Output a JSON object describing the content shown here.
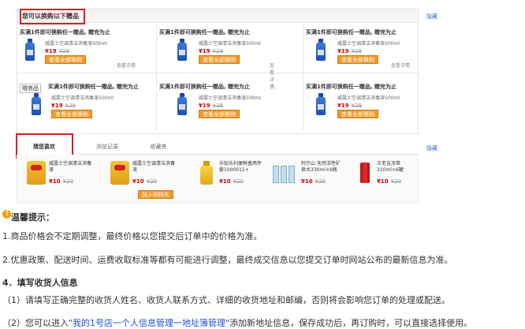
{
  "gift": {
    "title": "您可以换购以下赠品",
    "hide": "隐藏",
    "offer": "买满1件即可换购任一赠品, 赠完为止",
    "product": "威露士空调清洁消毒液500ml",
    "price": "¥19",
    "orig_price": "¥29",
    "button": "查看全部换购",
    "detail": "查看详情",
    "tag": "赠商品"
  },
  "tabs": {
    "items": [
      "猜您喜欢",
      "浏览记录",
      "收藏夹"
    ],
    "hide": "隐藏"
  },
  "recs": [
    {
      "name": "威露士空调清洁消毒液",
      "price": "¥10",
      "orig": "¥20",
      "icon": "chips-bag-icon"
    },
    {
      "name": "威露士空调清洁消毒液",
      "price": "¥10",
      "orig": "¥20",
      "icon": "chips-bag-icon"
    },
    {
      "name": "乐知乐扫便鲜盒两件套1000011+",
      "price": "¥10",
      "orig": "¥20",
      "icon": "bottle-icon"
    },
    {
      "name": "阿尔山 天然活性矿泉水330ml×6瓶",
      "price": "¥10",
      "orig": "¥20",
      "icon": "water-bottles-icon"
    },
    {
      "name": "王老吉凉茶310ml×6罐",
      "price": "¥10",
      "orig": "¥20",
      "icon": "can-icon"
    }
  ],
  "add_cart": "加入购物车",
  "tips": {
    "heading": "温馨提示：",
    "line1": "1.商品价格会不定期调整，最终价格以您提交后订单中的价格为准。",
    "line2": "2.优惠政策、配送时间、运费收取标准等都有可能进行调整，最终成交信息以您提交订单时网站公布的最新信息为准。"
  },
  "section4": {
    "heading": "4．填写收货人信息",
    "line1": "（1）请填写正确完整的收货人姓名、收货人联系方式、详细的收货地址和邮编，否则将会影响您订单的处理或配送。",
    "line2_pre": "（2）您可以进入",
    "line2_link": "\"我的1号店一个人信息管理一地址簿管理\"",
    "line2_post": "添加新地址信息，保存成功后，再订购时，可以直接选择使用。"
  },
  "colors": {
    "accent_red": "#d42020",
    "button_orange": "#f19a2a",
    "price_red": "#cc0000",
    "link_blue": "#1f4fd0"
  }
}
